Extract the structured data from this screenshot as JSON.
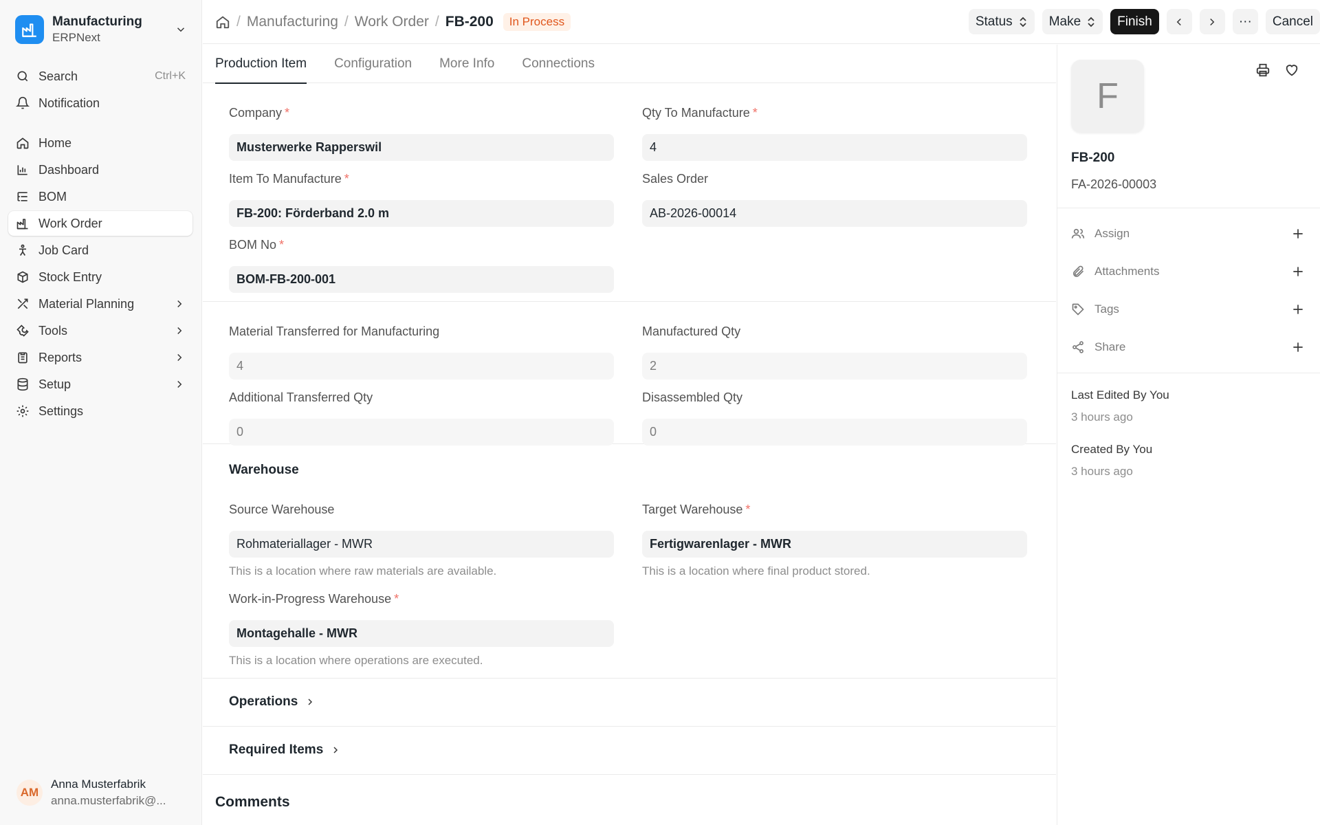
{
  "app": {
    "name": "Manufacturing",
    "subtitle": "ERPNext"
  },
  "sidebar": {
    "search": {
      "label": "Search",
      "shortcut": "Ctrl+K"
    },
    "notification": "Notification",
    "items": [
      {
        "label": "Home",
        "icon": "home-icon"
      },
      {
        "label": "Dashboard",
        "icon": "chart-icon"
      },
      {
        "label": "BOM",
        "icon": "list-tree-icon"
      },
      {
        "label": "Work Order",
        "icon": "factory-icon"
      },
      {
        "label": "Job Card",
        "icon": "person-icon"
      },
      {
        "label": "Stock Entry",
        "icon": "package-icon"
      },
      {
        "label": "Material Planning",
        "icon": "tools-icon"
      },
      {
        "label": "Tools",
        "icon": "wrench-icon"
      },
      {
        "label": "Reports",
        "icon": "clipboard-icon"
      },
      {
        "label": "Setup",
        "icon": "database-icon"
      },
      {
        "label": "Settings",
        "icon": "gear-icon"
      }
    ],
    "active_item": "Work Order"
  },
  "user": {
    "initials": "AM",
    "name": "Anna Musterfabrik",
    "email": "anna.musterfabrik@..."
  },
  "breadcrumb": {
    "module": "Manufacturing",
    "doctype": "Work Order",
    "current": "FB-200"
  },
  "status_badge": "In Process",
  "toolbar": {
    "status": "Status",
    "make": "Make",
    "finish": "Finish",
    "more": "···",
    "cancel": "Cancel"
  },
  "tabs": [
    "Production Item",
    "Configuration",
    "More Info",
    "Connections"
  ],
  "form": {
    "company": {
      "label": "Company",
      "value": "Musterwerke Rapperswil"
    },
    "qty_to_manufacture": {
      "label": "Qty To Manufacture",
      "value": "4"
    },
    "item_to_manufacture": {
      "label": "Item To Manufacture",
      "value": "FB-200: Förderband 2.0 m"
    },
    "sales_order": {
      "label": "Sales Order",
      "value": "AB-2026-00014"
    },
    "bom_no": {
      "label": "BOM No",
      "value": "BOM-FB-200-001"
    },
    "material_transferred": {
      "label": "Material Transferred for Manufacturing",
      "value": "4"
    },
    "manufactured_qty": {
      "label": "Manufactured Qty",
      "value": "2"
    },
    "additional_transferred": {
      "label": "Additional Transferred Qty",
      "value": "0"
    },
    "disassembled_qty": {
      "label": "Disassembled Qty",
      "value": "0"
    },
    "warehouse_section": "Warehouse",
    "source_warehouse": {
      "label": "Source Warehouse",
      "value": "Rohmateriallager - MWR",
      "help": "This is a location where raw materials are available."
    },
    "target_warehouse": {
      "label": "Target Warehouse",
      "value": "Fertigwarenlager - MWR",
      "help": "This is a location where final product stored."
    },
    "wip_warehouse": {
      "label": "Work-in-Progress Warehouse",
      "value": "Montagehalle - MWR",
      "help": "This is a location where operations are executed."
    },
    "operations": "Operations",
    "required_items": "Required Items",
    "comments": "Comments"
  },
  "right_panel": {
    "avatar_letter": "F",
    "title": "FB-200",
    "subtitle": "FA-2026-00003",
    "rows": [
      "Assign",
      "Attachments",
      "Tags",
      "Share"
    ],
    "last_edited": "Last Edited By You",
    "last_edited_time": "3 hours ago",
    "created": "Created By You",
    "created_time": "3 hours ago"
  },
  "colors": {
    "accent": "#1f8ef1",
    "badge_text": "#e0571d",
    "badge_bg": "#fff1e7",
    "primary_button": "#171717"
  }
}
